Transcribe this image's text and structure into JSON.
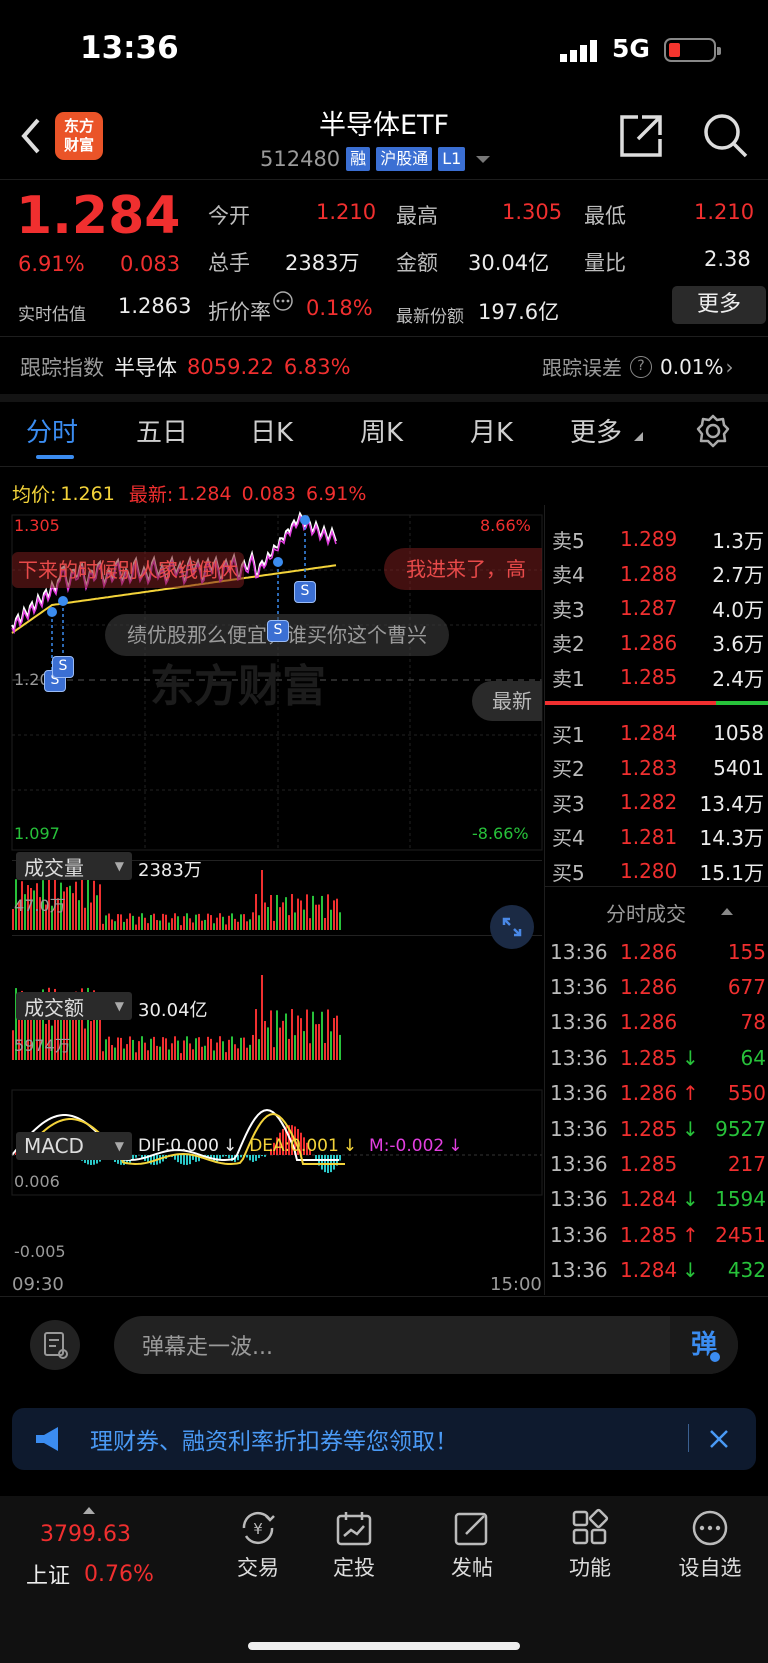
{
  "status": {
    "time": "13:36",
    "network": "5G"
  },
  "header": {
    "back_icon": "chevron-left-icon",
    "logo": "东方\n财富",
    "title": "半导体ETF",
    "code": "512480",
    "tags": [
      "融",
      "沪股通",
      "L1"
    ]
  },
  "quote": {
    "price": "1.284",
    "change_pct": "6.91%",
    "change": "0.083",
    "est_label": "实时估值",
    "est_value": "1.2863",
    "open_label": "今开",
    "open": "1.210",
    "high_label": "最高",
    "high": "1.305",
    "low_label": "最低",
    "low": "1.210",
    "vol_label": "总手",
    "vol": "2383万",
    "amt_label": "金额",
    "amt": "30.04亿",
    "ratio_label": "量比",
    "ratio": "2.38",
    "premium_label": "折价率",
    "premium": "0.18%",
    "shares_label": "最新份额",
    "shares": "197.6亿",
    "more_label": "更多"
  },
  "tracking": {
    "label": "跟踪指数",
    "index": "半导体",
    "value": "8059.22",
    "pct": "6.83%",
    "err_label": "跟踪误差",
    "err": "0.01%"
  },
  "tabs": [
    "分时",
    "五日",
    "日K",
    "周K",
    "月K",
    "更多"
  ],
  "intraday": {
    "avg_label": "均价:",
    "avg": "1.261",
    "last_label": "最新:",
    "last": "1.284",
    "chg": "0.083",
    "pct": "6.91%",
    "y_top": "1.305",
    "y_bot": "1.097",
    "y_mid": "1.20",
    "pct_top": "8.66%",
    "pct_bot": "-8.66%",
    "latest_btn": "最新",
    "watermark": "东方财富",
    "danmu": [
      "下来的时候别人家线倒休",
      "我进来了，高",
      "绩优股那么便宜，谁买你这个曹兴"
    ],
    "buy_marker": "S"
  },
  "volume": {
    "label": "成交量",
    "value": "2383万",
    "max": "47.0万"
  },
  "amount": {
    "label": "成交额",
    "value": "30.04亿",
    "max": "5974万"
  },
  "macd": {
    "label": "MACD",
    "dif": "DIF:0.000",
    "dea": "DEA:0.001",
    "m": "M:-0.002",
    "top": "0.006",
    "bot": "-0.005",
    "t_start": "09:30",
    "t_end": "15:00"
  },
  "orderbook": {
    "sells": [
      {
        "label": "卖5",
        "price": "1.289",
        "vol": "1.3万"
      },
      {
        "label": "卖4",
        "price": "1.288",
        "vol": "2.7万"
      },
      {
        "label": "卖3",
        "price": "1.287",
        "vol": "4.0万"
      },
      {
        "label": "卖2",
        "price": "1.286",
        "vol": "3.6万"
      },
      {
        "label": "卖1",
        "price": "1.285",
        "vol": "2.4万"
      }
    ],
    "buys": [
      {
        "label": "买1",
        "price": "1.284",
        "vol": "1058"
      },
      {
        "label": "买2",
        "price": "1.283",
        "vol": "5401"
      },
      {
        "label": "买3",
        "price": "1.282",
        "vol": "13.4万"
      },
      {
        "label": "买4",
        "price": "1.281",
        "vol": "14.3万"
      },
      {
        "label": "买5",
        "price": "1.280",
        "vol": "15.1万"
      }
    ]
  },
  "ticks": {
    "title": "分时成交",
    "rows": [
      {
        "time": "13:36",
        "price": "1.286",
        "arrow": "",
        "vol": "155",
        "dir": "red"
      },
      {
        "time": "13:36",
        "price": "1.286",
        "arrow": "",
        "vol": "677",
        "dir": "red"
      },
      {
        "time": "13:36",
        "price": "1.286",
        "arrow": "",
        "vol": "78",
        "dir": "red"
      },
      {
        "time": "13:36",
        "price": "1.285",
        "arrow": "↓",
        "vol": "64",
        "dir": "green"
      },
      {
        "time": "13:36",
        "price": "1.286",
        "arrow": "↑",
        "vol": "550",
        "dir": "red"
      },
      {
        "time": "13:36",
        "price": "1.285",
        "arrow": "↓",
        "vol": "9527",
        "dir": "green"
      },
      {
        "time": "13:36",
        "price": "1.285",
        "arrow": "",
        "vol": "217",
        "dir": "red"
      },
      {
        "time": "13:36",
        "price": "1.284",
        "arrow": "↓",
        "vol": "1594",
        "dir": "green"
      },
      {
        "time": "13:36",
        "price": "1.285",
        "arrow": "↑",
        "vol": "2451",
        "dir": "red"
      },
      {
        "time": "13:36",
        "price": "1.284",
        "arrow": "↓",
        "vol": "432",
        "dir": "green"
      }
    ]
  },
  "comment": {
    "placeholder": "弹幕走一波...",
    "danmu_btn": "弹"
  },
  "promo": {
    "text": "理财券、融资利率折扣券等您领取！"
  },
  "bottom": {
    "index_value": "3799.63",
    "index_name": "上证",
    "index_pct": "0.76%",
    "items": [
      {
        "icon": "yuan-exchange-icon",
        "label": "交易"
      },
      {
        "icon": "calendar-chart-icon",
        "label": "定投"
      },
      {
        "icon": "edit-icon",
        "label": "发帖"
      },
      {
        "icon": "grid-icon",
        "label": "功能"
      },
      {
        "icon": "more-circle-icon",
        "label": "设自选"
      }
    ]
  },
  "colors": {
    "up": "#f02f2f",
    "down": "#27c23a",
    "avg": "#f3d33a",
    "price": "#ffffff",
    "accent": "#3b8cf0"
  }
}
